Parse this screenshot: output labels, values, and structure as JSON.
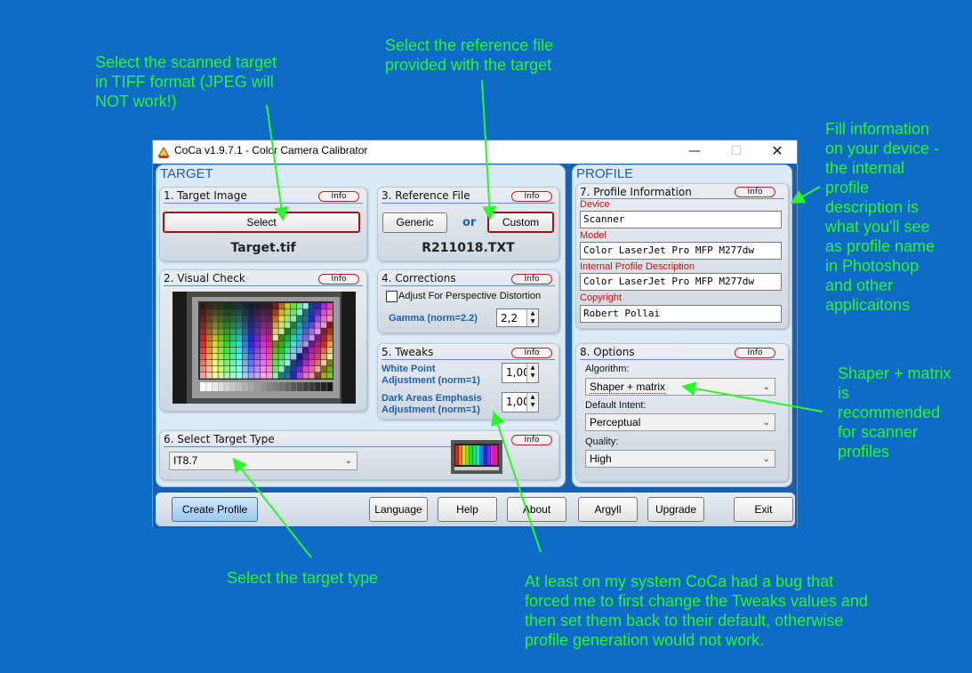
{
  "annotations": {
    "scanned_target": "Select the scanned target\nin TIFF format (JPEG will\nNOT work!)",
    "reference_file": "Select the reference file\nprovided with the target",
    "fill_info": "Fill information\non your device -\nthe internal\nprofile\ndescription is\nwhat you'll see\nas profile name\nin Photoshop\nand other\napplicaitons",
    "shaper": "Shaper + matrix\nis\nrecommended\nfor scanner\nprofiles",
    "target_type": "Select the target type",
    "bug_note": "At least on my system CoCa had a bug that\nforced me to first change the Tweaks values and\nthen set them back to their default, otherwise\nprofile generation would not work."
  },
  "window": {
    "title": "CoCa v1.9.7.1 - Color Camera Calibrator",
    "minimize": "—",
    "maximize": "☐",
    "close": "✕"
  },
  "target": {
    "heading": "TARGET",
    "info_label": "Info",
    "target_image": {
      "title": "1. Target Image",
      "select_button": "Select",
      "filename": "Target.tif"
    },
    "reference_file": {
      "title": "3. Reference File",
      "generic_button": "Generic",
      "or_label": "or",
      "custom_button": "Custom",
      "filename": "R211018.TXT"
    },
    "visual_check": {
      "title": "2. Visual Check"
    },
    "corrections": {
      "title": "4. Corrections",
      "perspective_label": "Adjust For Perspective Distortion",
      "gamma_label": "Gamma (norm=2.2)",
      "gamma_value": "2,2"
    },
    "tweaks": {
      "title": "5. Tweaks",
      "white_point_label_1": "White Point",
      "white_point_label_2": "Adjustment (norm=1)",
      "white_point_value": "1,00",
      "dark_label_1": "Dark Areas Emphasis",
      "dark_label_2": "Adjustment (norm=1)",
      "dark_value": "1,00"
    },
    "target_type": {
      "title": "6. Select Target Type",
      "selected": "IT8.7"
    }
  },
  "profile": {
    "heading": "PROFILE",
    "info": {
      "title": "7. Profile Information",
      "device_label": "Device",
      "device_value": "Scanner",
      "model_label": "Model",
      "model_value": "Color LaserJet Pro MFP M277dw",
      "description_label": "Internal Profile Description",
      "description_value": "Color LaserJet Pro MFP M277dw",
      "copyright_label": "Copyright",
      "copyright_value": "Robert Pollai"
    },
    "options": {
      "title": "8. Options",
      "algorithm_label": "Algorithm:",
      "algorithm_value": "Shaper + matrix",
      "intent_label": "Default Intent:",
      "intent_value": "Perceptual",
      "quality_label": "Quality:",
      "quality_value": "High"
    }
  },
  "bottom_buttons": {
    "create_profile": "Create Profile",
    "language": "Language",
    "help": "Help",
    "about": "About",
    "argyll": "Argyll",
    "upgrade": "Upgrade",
    "exit": "Exit"
  },
  "colors": {
    "background": "#0e6bc6",
    "annotation": "#2df52d",
    "section_blue": "#1f5fb0",
    "info_border": "#bb2222"
  }
}
